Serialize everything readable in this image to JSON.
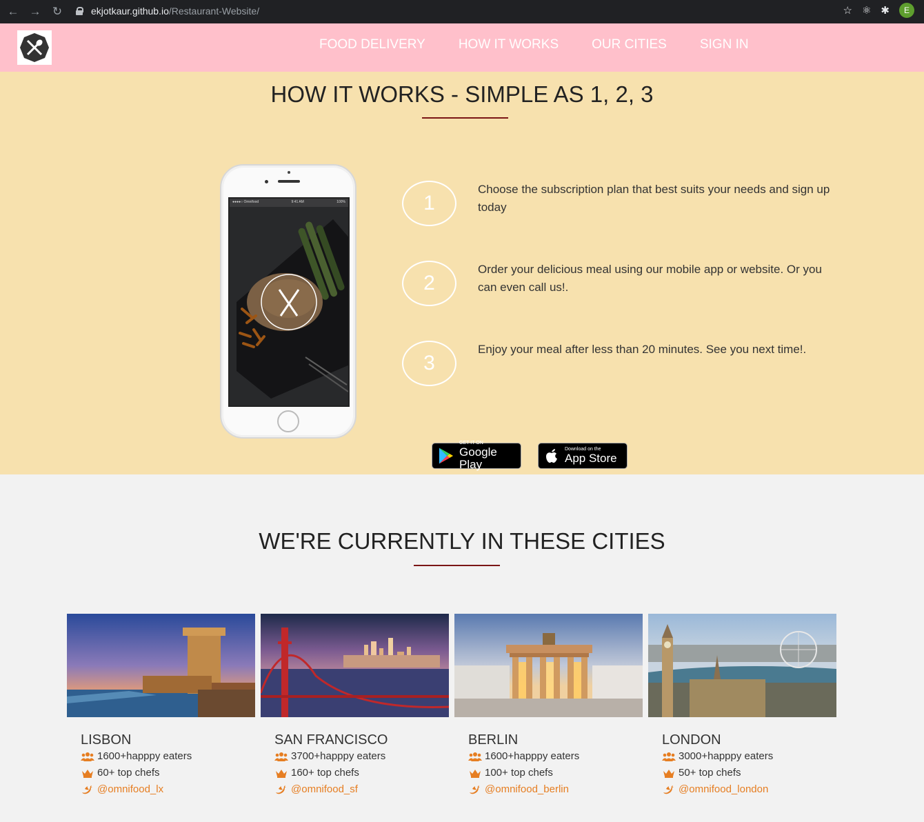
{
  "browser": {
    "url_host": "ekjotkaur.github.io",
    "url_path": "/Restaurant-Website/",
    "avatar_letter": "E"
  },
  "nav": {
    "items": [
      "FOOD DELIVERY",
      "HOW IT WORKS",
      "OUR CITIES",
      "SIGN IN"
    ]
  },
  "how_it_works": {
    "title": "HOW IT WORKS - SIMPLE AS 1, 2, 3",
    "steps": [
      {
        "number": "1",
        "text": "Choose the subscription plan that best suits your needs and sign up today"
      },
      {
        "number": "2",
        "text": "Order your delicious meal using our mobile app or website. Or you can even call us!."
      },
      {
        "number": "3",
        "text": "Enjoy your meal after less than 20 minutes. See you next time!."
      }
    ],
    "phone_status": {
      "carrier": "●●●●○ Omnifood",
      "time": "9:41 AM",
      "battery": "100%"
    },
    "google_play": {
      "small": "GET IT ON",
      "big": "Google Play"
    },
    "app_store": {
      "small": "Download on the",
      "big": "App Store"
    }
  },
  "cities_section": {
    "title": "WE'RE CURRENTLY IN THESE CITIES",
    "cities": [
      {
        "name": "LISBON",
        "eaters": "1600+happpy eaters",
        "chefs": "60+ top chefs",
        "twitter": "@omnifood_lx"
      },
      {
        "name": "SAN FRANCISCO",
        "eaters": "3700+happpy eaters",
        "chefs": "160+ top chefs",
        "twitter": "@omnifood_sf"
      },
      {
        "name": "BERLIN",
        "eaters": "1600+happpy eaters",
        "chefs": "100+ top chefs",
        "twitter": "@omnifood_berlin"
      },
      {
        "name": "LONDON",
        "eaters": "3000+happpy eaters",
        "chefs": "50+ top chefs",
        "twitter": "@omnifood_london"
      }
    ]
  },
  "colors": {
    "header_bg": "#ffc0cb",
    "how_bg": "#f7e1ae",
    "accent_rule": "#7a1515",
    "icon_orange": "#e67e22"
  }
}
